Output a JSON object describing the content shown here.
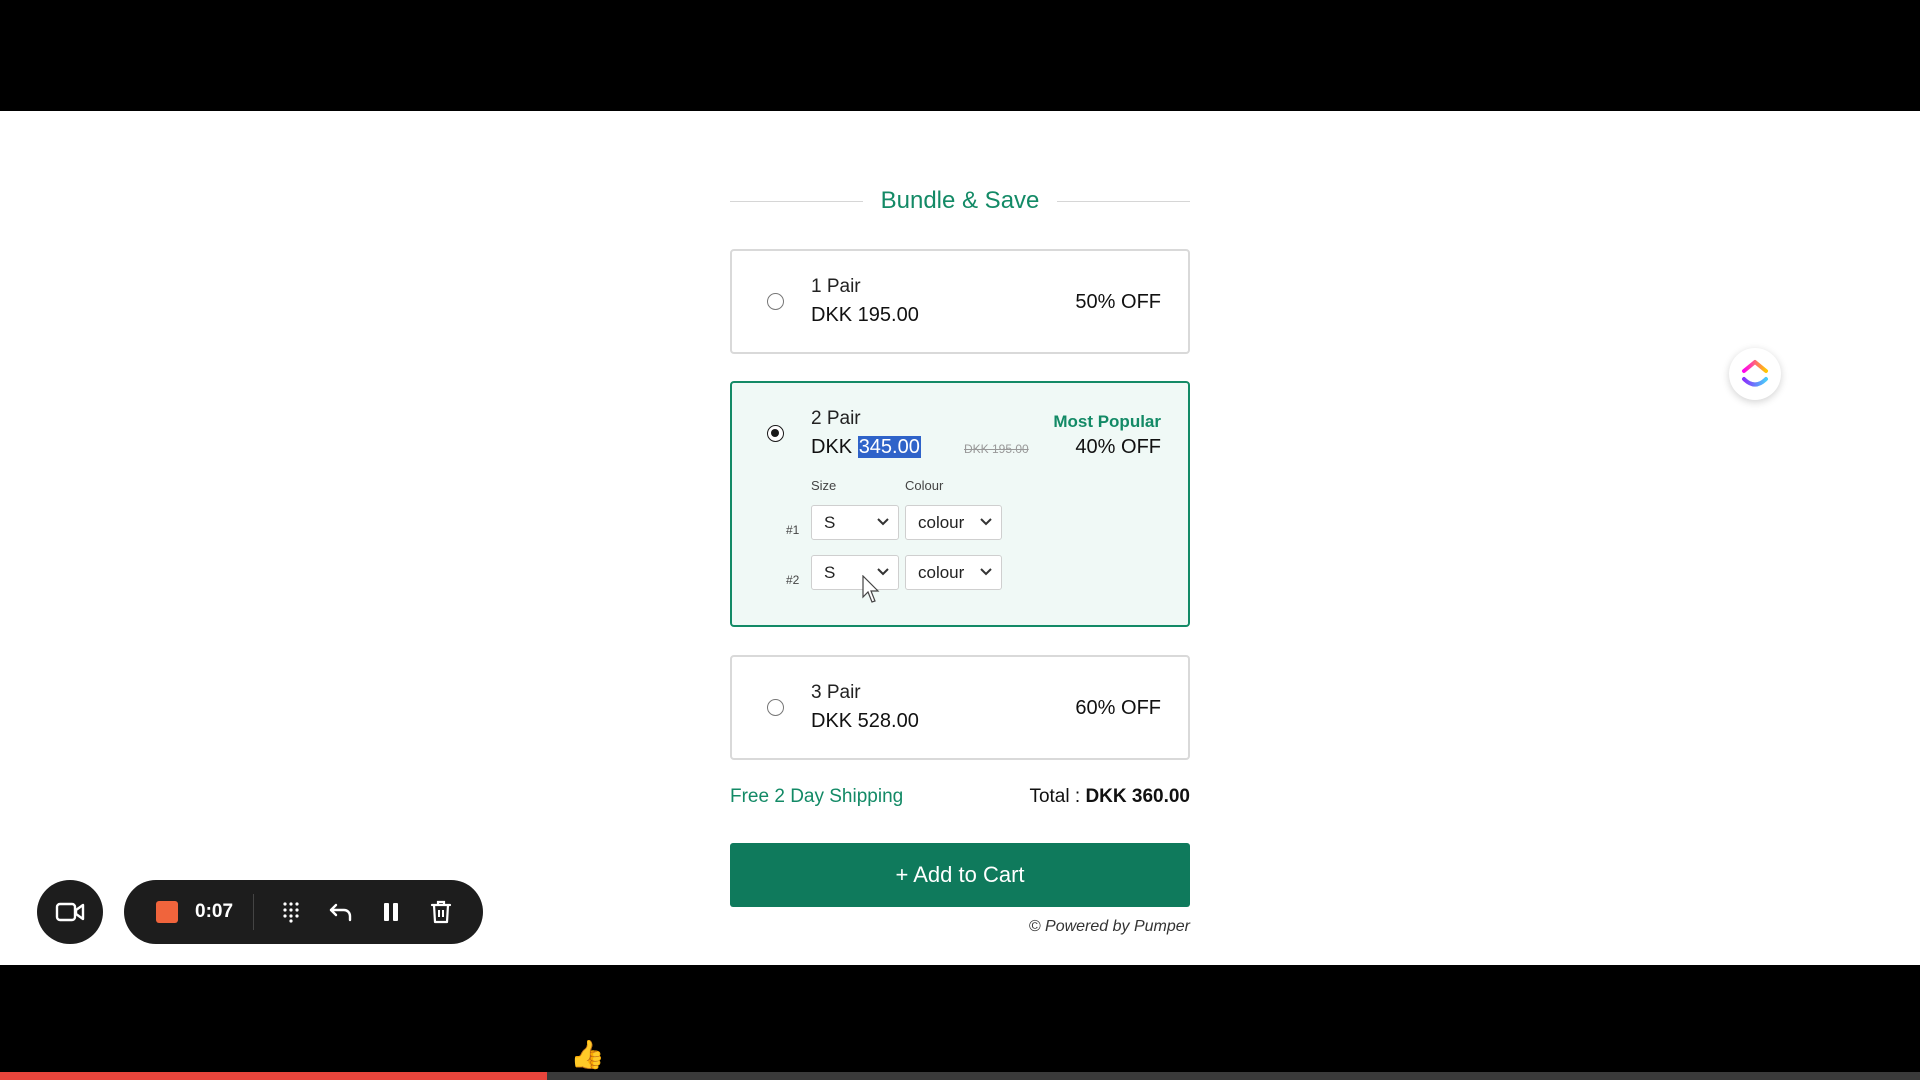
{
  "bundle": {
    "title": "Bundle & Save",
    "options": [
      {
        "name": "1 Pair",
        "price": "DKK 195.00",
        "discount": "50% OFF",
        "selected": false
      },
      {
        "name": "2 Pair",
        "price_prefix": "DKK ",
        "price_value": "345.00",
        "old_price": "DKK 195.00",
        "badge": "Most Popular",
        "discount": "40% OFF",
        "selected": true,
        "size_label": "Size",
        "colour_label": "Colour",
        "items": [
          {
            "num": "#1",
            "size": "S",
            "colour": "colour"
          },
          {
            "num": "#2",
            "size": "S",
            "colour": "colour"
          }
        ]
      },
      {
        "name": "3 Pair",
        "price": "DKK 528.00",
        "discount": "60% OFF",
        "selected": false
      }
    ]
  },
  "footer": {
    "shipping": "Free 2 Day Shipping",
    "total_label": "Total : ",
    "total_value": "DKK 360.00",
    "add_to_cart": "+ Add to Cart",
    "powered_by": "© Powered by Pumper"
  },
  "recorder": {
    "time": "0:07",
    "stop_color": "#f0643c",
    "progress_fraction": 0.285
  },
  "colors": {
    "accent": "#138a66",
    "button": "#0f7a5c",
    "highlight": "#2f63c9"
  },
  "icons": [
    "video-camera-icon",
    "stop-icon",
    "grid-icon",
    "undo-icon",
    "pause-icon",
    "trash-icon",
    "clickup-logo-icon",
    "chevron-down-icon",
    "thumbs-up-icon"
  ],
  "emoji": "👍"
}
